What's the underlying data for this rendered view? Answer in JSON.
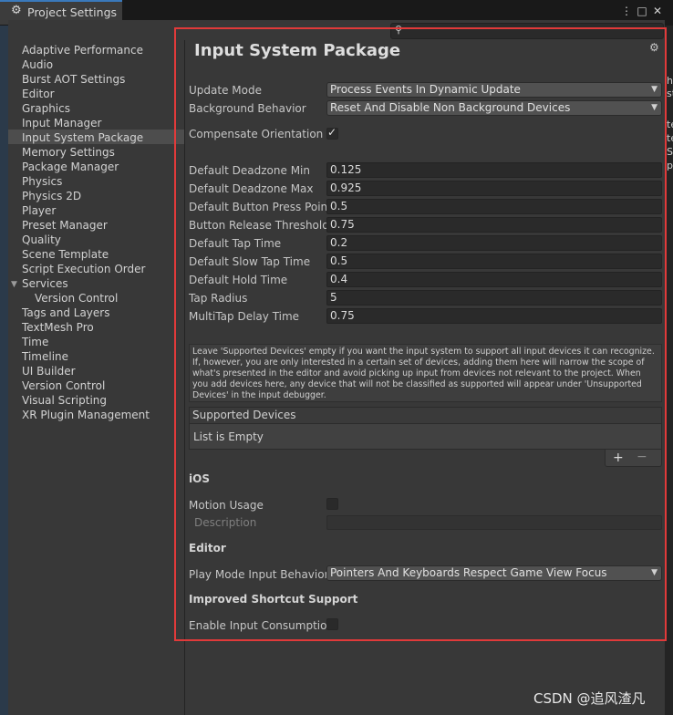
{
  "window": {
    "title": "Project Settings",
    "controls": [
      "⋮",
      "□",
      "✕"
    ]
  },
  "search": {
    "placeholder": ""
  },
  "sidebar": {
    "items": [
      {
        "label": "Adaptive Performance"
      },
      {
        "label": "Audio"
      },
      {
        "label": "Burst AOT Settings"
      },
      {
        "label": "Editor"
      },
      {
        "label": "Graphics"
      },
      {
        "label": "Input Manager"
      },
      {
        "label": "Input System Package",
        "selected": true
      },
      {
        "label": "Memory Settings"
      },
      {
        "label": "Package Manager"
      },
      {
        "label": "Physics"
      },
      {
        "label": "Physics 2D"
      },
      {
        "label": "Player"
      },
      {
        "label": "Preset Manager"
      },
      {
        "label": "Quality"
      },
      {
        "label": "Scene Template"
      },
      {
        "label": "Script Execution Order"
      },
      {
        "label": "Services",
        "expanded": true
      },
      {
        "label": "Version Control",
        "sub": true
      },
      {
        "label": "Tags and Layers"
      },
      {
        "label": "TextMesh Pro"
      },
      {
        "label": "Time"
      },
      {
        "label": "Timeline"
      },
      {
        "label": "UI Builder"
      },
      {
        "label": "Version Control"
      },
      {
        "label": "Visual Scripting"
      },
      {
        "label": "XR Plugin Management"
      }
    ]
  },
  "main": {
    "title": "Input System Package",
    "update_mode": {
      "label": "Update Mode",
      "value": "Process Events In Dynamic Update"
    },
    "background_behavior": {
      "label": "Background Behavior",
      "value": "Reset And Disable Non Background Devices"
    },
    "compensate_orientation": {
      "label": "Compensate Orientation",
      "checked": true
    },
    "fields": [
      {
        "label": "Default Deadzone Min",
        "value": "0.125"
      },
      {
        "label": "Default Deadzone Max",
        "value": "0.925"
      },
      {
        "label": "Default Button Press Point",
        "value": "0.5"
      },
      {
        "label": "Button Release Threshold",
        "value": "0.75"
      },
      {
        "label": "Default Tap Time",
        "value": "0.2"
      },
      {
        "label": "Default Slow Tap Time",
        "value": "0.5"
      },
      {
        "label": "Default Hold Time",
        "value": "0.4"
      },
      {
        "label": "Tap Radius",
        "value": "5"
      },
      {
        "label": "MultiTap Delay Time",
        "value": "0.75"
      }
    ],
    "help_text": "Leave 'Supported Devices' empty if you want the input system to support all input devices it can recognize. If, however, you are only interested in a certain set of devices, adding them here will narrow the scope of what's presented in the editor and avoid picking up input from devices not relevant to the project. When you add devices here, any device that will not be classified as supported will appear under 'Unsupported Devices' in the input debugger.",
    "supported_devices": {
      "header": "Supported Devices",
      "empty_text": "List is Empty",
      "add": "+",
      "remove": "−"
    },
    "ios": {
      "heading": "iOS",
      "motion_usage": {
        "label": "Motion Usage",
        "checked": false
      },
      "description": {
        "label": "Description",
        "value": ""
      }
    },
    "editor": {
      "heading": "Editor",
      "play_mode": {
        "label": "Play Mode Input Behavior",
        "value": "Pointers And Keyboards Respect Game View Focus"
      }
    },
    "shortcut": {
      "heading": "Improved Shortcut Support",
      "enable_input_consumption": {
        "label": "Enable Input Consumption",
        "checked": false
      }
    }
  },
  "edge_glyphs": [
    "h",
    "st",
    "te",
    "te",
    "S",
    "p"
  ],
  "watermark": "CSDN @追风渣凡",
  "colors": {
    "accent_tab": "#3a79bb",
    "highlight_box": "#e13a3a",
    "selected_row": "#4d4d4d"
  }
}
